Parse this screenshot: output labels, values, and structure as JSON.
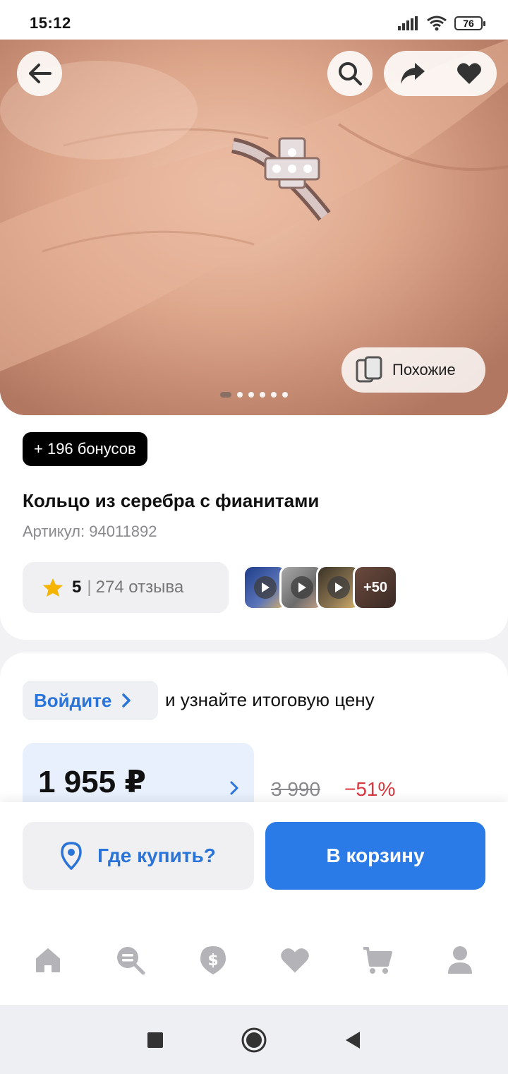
{
  "status": {
    "time": "15:12",
    "battery": "76"
  },
  "hero": {
    "similar_label": "Похожие",
    "slide_count": 6,
    "active_slide": 1
  },
  "product": {
    "bonus": "+ 196 бонусов",
    "title": "Кольцо из серебра с фианитами",
    "article_label": "Артикул:",
    "article_value": "94011892",
    "rating": "5",
    "reviews": "274 отзыва",
    "media_more": "+50"
  },
  "pricing": {
    "login_label": "Войдите",
    "login_hint": "и узнайте итоговую цену",
    "price": "1 955 ₽",
    "old_price": "3 990",
    "discount": "−51%"
  },
  "actions": {
    "where_to_buy": "Где купить?",
    "add_to_cart": "В корзину"
  },
  "colors": {
    "accent": "#2a7ae8",
    "discount": "#d9363e",
    "price_bg": "#e7f0fc"
  },
  "tabs": [
    "home-icon",
    "catalog-search-icon",
    "bonus-icon",
    "favorites-icon",
    "cart-icon",
    "profile-icon"
  ]
}
